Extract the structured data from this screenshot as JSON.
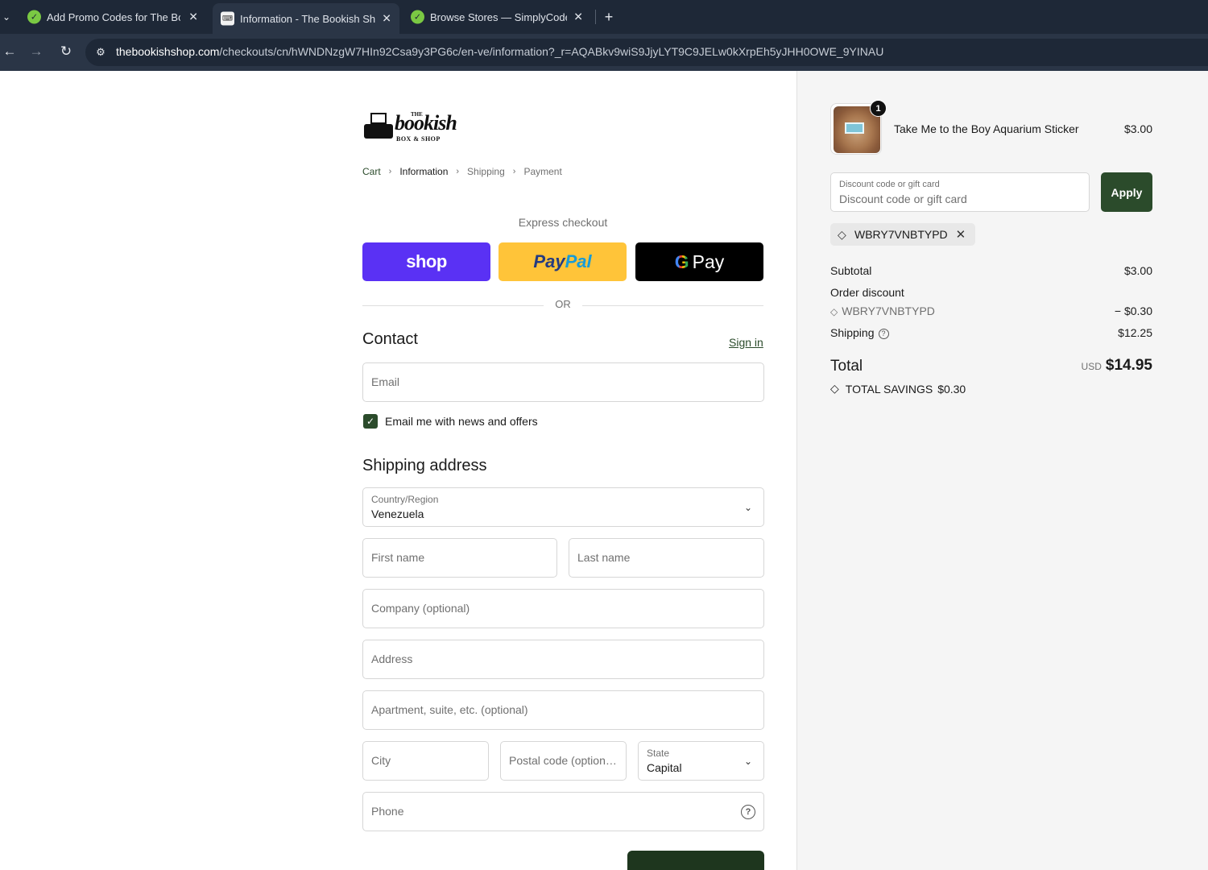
{
  "browser": {
    "tabs": [
      {
        "title": "Add Promo Codes for The Book",
        "active": false
      },
      {
        "title": "Information - The Bookish Shop",
        "active": true
      },
      {
        "title": "Browse Stores — SimplyCodes",
        "active": false
      }
    ],
    "url_host": "thebookishshop.com",
    "url_path": "/checkouts/cn/hWNDNzgW7HIn92Csa9y3PG6c/en-ve/information?_r=AQABkv9wiS9JjyLYT9C9JELw0kXrpEh5yJHH0OWE_9YINAU"
  },
  "logo": {
    "the": "THE",
    "bookish": "bookish",
    "box_shop": "BOX & SHOP"
  },
  "breadcrumb": {
    "cart": "Cart",
    "information": "Information",
    "shipping": "Shipping",
    "payment": "Payment"
  },
  "express": {
    "label": "Express checkout",
    "shop": "shop",
    "paypal_1": "Pay",
    "paypal_2": "Pal",
    "gpay_g": "G",
    "gpay_text": "Pay",
    "or": "OR"
  },
  "contact": {
    "title": "Contact",
    "sign_in": "Sign in",
    "email_placeholder": "Email",
    "newsletter_label": "Email me with news and offers",
    "newsletter_checked": true
  },
  "shipping": {
    "title": "Shipping address",
    "country_label": "Country/Region",
    "country_value": "Venezuela",
    "first_name": "First name",
    "last_name": "Last name",
    "company": "Company (optional)",
    "address": "Address",
    "apartment": "Apartment, suite, etc. (optional)",
    "city": "City",
    "postal": "Postal code (option…",
    "state_label": "State",
    "state_value": "Capital",
    "phone": "Phone"
  },
  "summary": {
    "item": {
      "quantity": "1",
      "name": "Take Me to the Boy Aquarium Sticker",
      "price": "$3.00"
    },
    "discount_label": "Discount code or gift card",
    "discount_placeholder": "Discount code or gift card",
    "apply": "Apply",
    "applied_code": "WBRY7VNBTYPD",
    "subtotal_label": "Subtotal",
    "subtotal_value": "$3.00",
    "order_discount_label": "Order discount",
    "discount_code": "WBRY7VNBTYPD",
    "discount_value": "− $0.30",
    "shipping_label": "Shipping",
    "shipping_value": "$12.25",
    "total_label": "Total",
    "currency": "USD",
    "total_value": "$14.95",
    "savings_label": "TOTAL SAVINGS",
    "savings_value": "$0.30"
  },
  "colors": {
    "accent": "#2b4b2b",
    "shop_pay": "#5a31f4",
    "paypal": "#ffc439",
    "gpay": "#000000"
  }
}
